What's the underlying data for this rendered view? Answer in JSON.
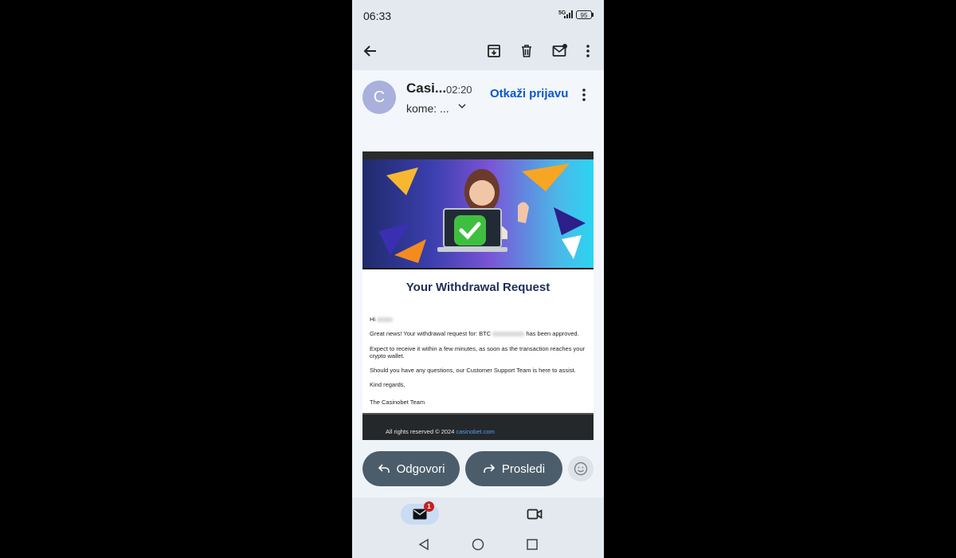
{
  "status_bar": {
    "time": "06:33",
    "network": "5G",
    "battery": "95"
  },
  "toolbar": {
    "back_icon": "arrow-left-icon",
    "archive_icon": "archive-icon",
    "delete_icon": "trash-icon",
    "mark_unread_icon": "mail-dot-icon",
    "more_icon": "kebab-icon"
  },
  "message_header": {
    "avatar_letter": "C",
    "sender": "Casi...",
    "time": "02:20",
    "to": "kome: ...",
    "unsubscribe": "Otkaži prijavu"
  },
  "email": {
    "headline": "Your Withdrawal Request",
    "greeting": "Hi",
    "line1_start": "Great news! Your withdrawal request for: BTC",
    "line1_end": "has been approved.",
    "line2": "Expect to receive it within a few minutes, as soon as the transaction reaches your crypto wallet.",
    "line3": "Should you have any questions, our Customer Support Team is here to assist.",
    "line4": "Kind regards,",
    "signature": "The Casinobet Team",
    "footer_text": "All rights reserved © 2024",
    "footer_link": "casinobet.com"
  },
  "actions": {
    "reply": "Odgovori",
    "forward": "Prosledi"
  },
  "bottom_nav": {
    "mail_badge": "1"
  },
  "colors": {
    "accent": "#0b57d0",
    "button": "#4b5d6a",
    "headline": "#1f2d59"
  }
}
